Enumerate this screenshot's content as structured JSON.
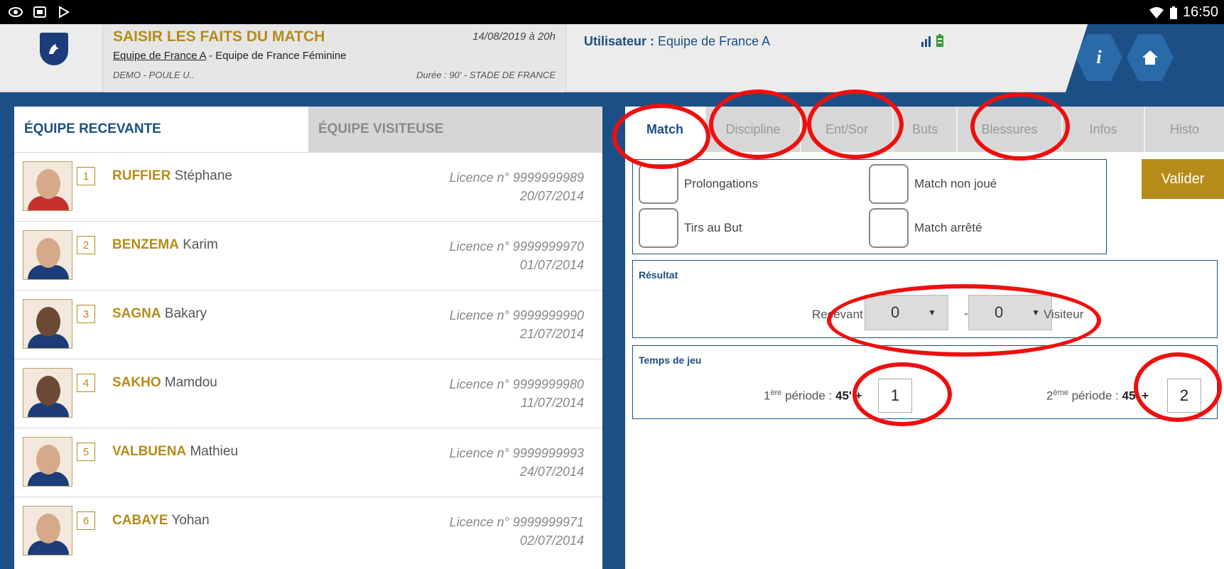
{
  "statusbar": {
    "icons": [
      "eye-icon",
      "cast-icon",
      "play-store-icon"
    ],
    "right_icons": [
      "wifi-icon",
      "battery-icon"
    ],
    "time": "16:50"
  },
  "header": {
    "title": "SAISIR LES FAITS DU MATCH",
    "date": "14/08/2019 à 20h",
    "home_team": "Equipe de France A",
    "separator": " - ",
    "away_team": "Equipe de France Féminine",
    "competition": "DEMO - POULE U..",
    "venue": "Durée : 90' - STADE DE FRANCE",
    "user_label": "Utilisateur :",
    "user_value": " Equipe de France A",
    "info_button": "i",
    "home_button_icon": "home-icon"
  },
  "left": {
    "tabs": [
      "ÉQUIPE RECEVANTE",
      "ÉQUIPE VISITEUSE"
    ],
    "players": [
      {
        "number": "1",
        "last": "RUFFIER",
        "first": "Stéphane",
        "licence": "Licence n° 9999999989",
        "date": "20/07/2014"
      },
      {
        "number": "2",
        "last": "BENZEMA",
        "first": "Karim",
        "licence": "Licence n° 9999999970",
        "date": "01/07/2014"
      },
      {
        "number": "3",
        "last": "SAGNA",
        "first": "Bakary",
        "licence": "Licence n° 9999999990",
        "date": "21/07/2014"
      },
      {
        "number": "4",
        "last": "SAKHO",
        "first": "Mamdou",
        "licence": "Licence n° 9999999980",
        "date": "11/07/2014"
      },
      {
        "number": "5",
        "last": "VALBUENA",
        "first": "Mathieu",
        "licence": "Licence n° 9999999993",
        "date": "24/07/2014"
      },
      {
        "number": "6",
        "last": "CABAYE",
        "first": "Yohan",
        "licence": "Licence n° 9999999971",
        "date": "02/07/2014"
      }
    ]
  },
  "right": {
    "tabs": [
      "Match",
      "Discipline",
      "Ent/Sor",
      "Buts",
      "Blessures",
      "Infos",
      "Histo"
    ],
    "options": [
      "Prolongations",
      "Match non joué",
      "Tirs au But",
      "Match arrêté"
    ],
    "valider": "Valider",
    "result": {
      "title": "Résultat",
      "home_label": "Recevant",
      "home_score": "0",
      "away_score": "0",
      "dash": "-",
      "away_label": "Visiteur"
    },
    "time": {
      "title": "Temps de jeu",
      "p1_num": "1",
      "p1_sup": "ère",
      "p1_text": " période : ",
      "p1_base": "45' +",
      "p1_value": "1",
      "p2_num": "2",
      "p2_sup": "ème",
      "p2_text": " période : ",
      "p2_base": "45' +",
      "p2_value": "2"
    }
  },
  "colors": {
    "brand_blue": "#1c4f85",
    "gold": "#b58c1a",
    "annotation_red": "#ef0f0f"
  }
}
